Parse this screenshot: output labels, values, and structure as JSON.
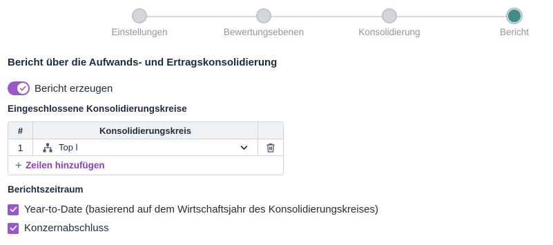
{
  "stepper": {
    "steps": [
      {
        "label": "Einstellungen",
        "state": "inactive"
      },
      {
        "label": "Bewertungsebenen",
        "state": "inactive"
      },
      {
        "label": "Konsolidierung",
        "state": "inactive"
      },
      {
        "label": "Bericht",
        "state": "active"
      }
    ]
  },
  "page": {
    "heading": "Bericht über die Aufwands- und Ertragskonsolidierung"
  },
  "toggle": {
    "label": "Bericht erzeugen",
    "checked": true
  },
  "included": {
    "heading": "Eingeschlossene Konsolidierungskreise",
    "table": {
      "columns": [
        "#",
        "Konsolidierungskreis",
        ""
      ],
      "rows": [
        {
          "num": "1",
          "kreis": "Top l",
          "icon": "hierarchy-icon"
        }
      ],
      "add_label": "Zeilen hinzufügen"
    }
  },
  "period": {
    "heading": "Berichtszeitraum",
    "options": [
      {
        "label": "Year-to-Date (basierend auf dem Wirtschaftsjahr des Konsolidierungskreises)",
        "checked": true
      },
      {
        "label": "Konzernabschluss",
        "checked": true
      }
    ]
  },
  "colors": {
    "accent": "#9a57c7",
    "active_step": "#3e8d86"
  }
}
